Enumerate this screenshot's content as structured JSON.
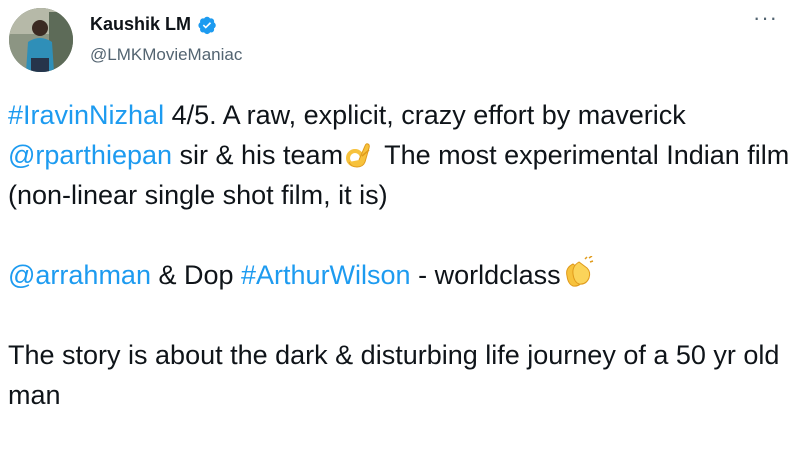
{
  "author": {
    "name": "Kaushik LM",
    "handle": "@LMKMovieManiac",
    "verified": true
  },
  "menu": {
    "more_label": "···"
  },
  "tweet": {
    "p1": {
      "hashtag1": "#IravinNizhal",
      "t1": " 4/5. A raw, explicit, crazy effort by maverick ",
      "mention1": "@rparthiepan",
      "t2": " sir & his team",
      "emoji1": "ok-hand",
      "t3": " The most experimental Indian film (non-linear single shot film, it is)"
    },
    "p2": {
      "mention2": "@arrahman",
      "t4": " & Dop ",
      "hashtag2": "#ArthurWilson",
      "t5": " - worldclass",
      "emoji2": "clapping-hands"
    },
    "p3": {
      "t6": "The story is about the dark & disturbing life journey of a 50 yr old man"
    }
  },
  "colors": {
    "link": "#1d9bf0",
    "text": "#0f1419",
    "muted": "#536471",
    "verified": "#1d9bf0"
  }
}
